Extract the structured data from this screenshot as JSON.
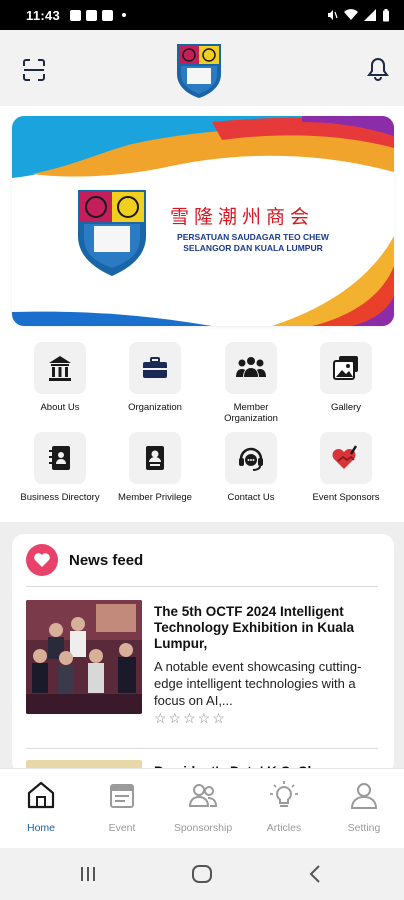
{
  "status_bar": {
    "time": "11:43"
  },
  "header": {
    "scan_icon": "scan-icon",
    "bell_icon": "bell-icon"
  },
  "banner": {
    "chinese_name": "雪隆潮州商会",
    "english_line1": "PERSATUAN SAUDAGAR TEO CHEW",
    "english_line2": "SELANGOR DAN KUALA LUMPUR"
  },
  "menu": [
    {
      "label": "About Us",
      "icon": "building-icon"
    },
    {
      "label": "Organization",
      "icon": "briefcase-icon"
    },
    {
      "label": "Member\nOrganization",
      "icon": "group-icon"
    },
    {
      "label": "Gallery",
      "icon": "gallery-icon"
    },
    {
      "label": "Business Directory",
      "icon": "directory-icon"
    },
    {
      "label": "Member Privilege",
      "icon": "badge-icon"
    },
    {
      "label": "Contact Us",
      "icon": "headset-icon"
    },
    {
      "label": "Event Sponsors",
      "icon": "handshake-heart-icon"
    }
  ],
  "news_feed": {
    "title": "News feed",
    "items": [
      {
        "title": "The 5th OCTF 2024 Intelligent Technology Exhibition in Kuala Lumpur,",
        "excerpt": "A notable event showcasing cutting-edge intelligent technologies with a focus on AI,...",
        "stars": "☆☆☆☆☆"
      },
      {
        "title": "President's Dato' K.C. Chua"
      }
    ]
  },
  "bottom_nav": [
    {
      "label": "Home",
      "icon": "home-icon",
      "active": true
    },
    {
      "label": "Event",
      "icon": "event-icon",
      "active": false
    },
    {
      "label": "Sponsorship",
      "icon": "sponsorship-icon",
      "active": false
    },
    {
      "label": "Articles",
      "icon": "articles-icon",
      "active": false
    },
    {
      "label": "Setting",
      "icon": "user-icon",
      "active": false
    }
  ],
  "colors": {
    "accent_blue": "#1d5fa6",
    "brand_red": "#d01a22",
    "brand_navy": "#1a3a8f",
    "heart_pink": "#e8426a"
  }
}
